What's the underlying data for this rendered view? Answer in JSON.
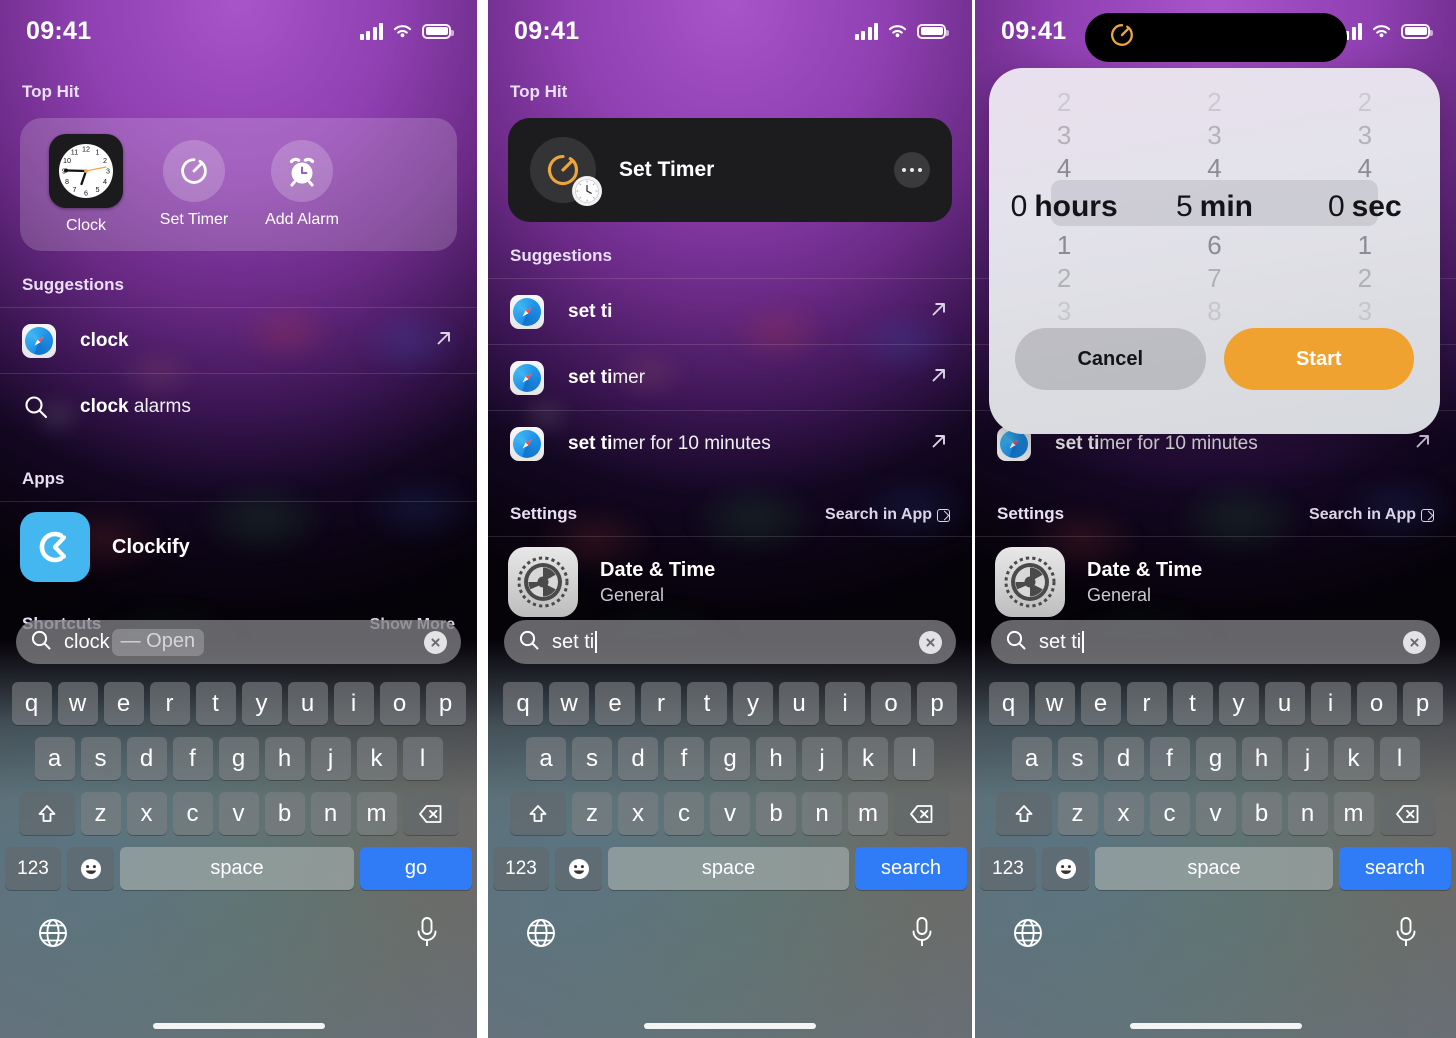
{
  "status_bar": {
    "time": "09:41",
    "signal_icon": "cellular-bars-icon",
    "wifi_icon": "wifi-icon",
    "battery_icon": "battery-icon"
  },
  "panel1": {
    "top_hit": {
      "header": "Top Hit",
      "items": [
        {
          "label": "Clock",
          "icon": "clock-app-icon"
        },
        {
          "label": "Set Timer",
          "icon": "timer-icon"
        },
        {
          "label": "Add Alarm",
          "icon": "alarm-clock-icon"
        }
      ]
    },
    "suggestions": {
      "header": "Suggestions",
      "items": [
        {
          "text": "clock",
          "bold": "clock",
          "rest": "",
          "icon": "safari-icon",
          "action_icon": "arrow-up-right-icon"
        },
        {
          "text": "clock alarms",
          "bold": "clock",
          "rest": " alarms",
          "icon": "search-icon",
          "action_icon": ""
        }
      ]
    },
    "apps": {
      "header": "Apps",
      "items": [
        {
          "name": "Clockify",
          "icon": "clockify-app-icon"
        }
      ]
    },
    "shortcuts": {
      "header": "Shortcuts",
      "show_more": "Show More"
    },
    "search": {
      "value": "clock",
      "completion": "— Open",
      "icon": "search-icon",
      "clear_icon": "clear-x-icon"
    },
    "keyboard": {
      "row1": [
        "q",
        "w",
        "e",
        "r",
        "t",
        "y",
        "u",
        "i",
        "o",
        "p"
      ],
      "row2": [
        "a",
        "s",
        "d",
        "f",
        "g",
        "h",
        "j",
        "k",
        "l"
      ],
      "row3": [
        "z",
        "x",
        "c",
        "v",
        "b",
        "n",
        "m"
      ],
      "shift_icon": "shift-icon",
      "backspace_icon": "backspace-icon",
      "numbers_key": "123",
      "emoji_key": "emoji-icon",
      "space_key": "space",
      "action_key": "go",
      "globe_icon": "globe-icon",
      "mic_icon": "microphone-icon"
    }
  },
  "panel2": {
    "top_hit": {
      "header": "Top Hit",
      "title": "Set Timer",
      "icon": "timer-icon",
      "badge_icon": "clock-app-icon",
      "more_icon": "more-ellipsis-icon"
    },
    "suggestions": {
      "header": "Suggestions",
      "items": [
        {
          "text": "set ti",
          "bold": "set ti",
          "rest": "",
          "icon": "safari-icon",
          "action_icon": "arrow-up-right-icon"
        },
        {
          "text": "set timer",
          "bold": "set ti",
          "rest": "mer",
          "icon": "safari-icon",
          "action_icon": "arrow-up-right-icon"
        },
        {
          "text": "set timer for 10 minutes",
          "bold": "set ti",
          "rest": "mer for 10 minutes",
          "icon": "safari-icon",
          "action_icon": "arrow-up-right-icon"
        }
      ]
    },
    "settings": {
      "header": "Settings",
      "search_in_app": "Search in App",
      "search_in_app_icon": "open-in-app-icon",
      "items": [
        {
          "title": "Date & Time",
          "subtitle": "General",
          "icon": "settings-gear-icon"
        }
      ]
    },
    "search": {
      "value": "set ti",
      "completion": "",
      "icon": "search-icon",
      "clear_icon": "clear-x-icon"
    },
    "keyboard": {
      "row1": [
        "q",
        "w",
        "e",
        "r",
        "t",
        "y",
        "u",
        "i",
        "o",
        "p"
      ],
      "row2": [
        "a",
        "s",
        "d",
        "f",
        "g",
        "h",
        "j",
        "k",
        "l"
      ],
      "row3": [
        "z",
        "x",
        "c",
        "v",
        "b",
        "n",
        "m"
      ],
      "shift_icon": "shift-icon",
      "backspace_icon": "backspace-icon",
      "numbers_key": "123",
      "emoji_key": "emoji-icon",
      "space_key": "space",
      "action_key": "search",
      "globe_icon": "globe-icon",
      "mic_icon": "microphone-icon"
    }
  },
  "panel3": {
    "dynamic_island": {
      "icon": "timer-icon"
    },
    "timer_dialog": {
      "hours": {
        "above": [
          "2",
          "3",
          "4"
        ],
        "selected_value": "0",
        "selected_unit": "hours",
        "below": [
          "1",
          "2",
          "3"
        ]
      },
      "minutes": {
        "above": [
          "2",
          "3",
          "4"
        ],
        "selected_value": "5",
        "selected_unit": "min",
        "below": [
          "6",
          "7",
          "8"
        ]
      },
      "seconds": {
        "above": [
          "2",
          "3",
          "4"
        ],
        "selected_value": "0",
        "selected_unit": "sec",
        "below": [
          "1",
          "2",
          "3"
        ]
      },
      "cancel_label": "Cancel",
      "start_label": "Start",
      "start_color": "#f0a230"
    },
    "settings": {
      "header": "Settings",
      "search_in_app": "Search in App",
      "search_in_app_icon": "open-in-app-icon",
      "items": [
        {
          "title": "Date & Time",
          "subtitle": "General",
          "icon": "settings-gear-icon"
        }
      ]
    },
    "search": {
      "value": "set ti",
      "completion": "",
      "icon": "search-icon",
      "clear_icon": "clear-x-icon"
    },
    "keyboard": {
      "row1": [
        "q",
        "w",
        "e",
        "r",
        "t",
        "y",
        "u",
        "i",
        "o",
        "p"
      ],
      "row2": [
        "a",
        "s",
        "d",
        "f",
        "g",
        "h",
        "j",
        "k",
        "l"
      ],
      "row3": [
        "z",
        "x",
        "c",
        "v",
        "b",
        "n",
        "m"
      ],
      "shift_icon": "shift-icon",
      "backspace_icon": "backspace-icon",
      "numbers_key": "123",
      "emoji_key": "emoji-icon",
      "space_key": "space",
      "action_key": "search",
      "globe_icon": "globe-icon",
      "mic_icon": "microphone-icon"
    }
  }
}
